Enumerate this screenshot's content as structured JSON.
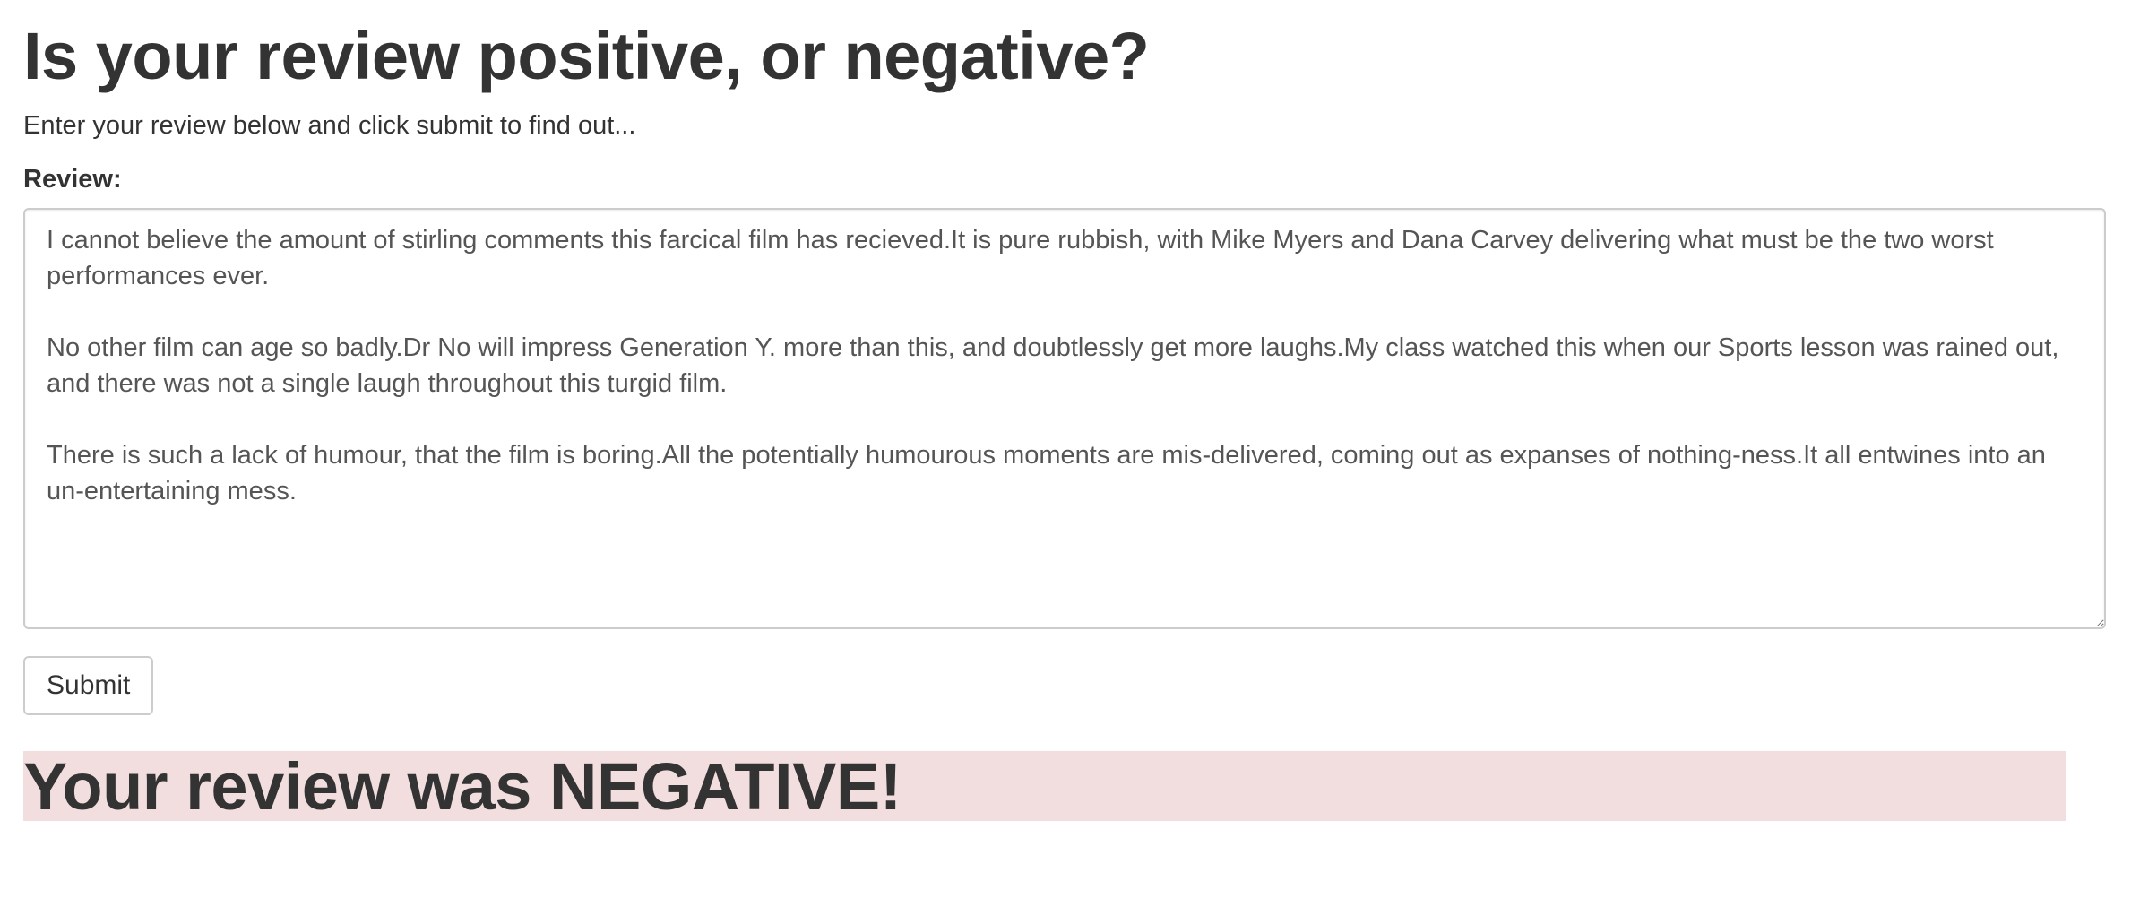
{
  "page": {
    "title": "Is your review positive, or negative?",
    "subtitle": "Enter your review below and click submit to find out...",
    "review_label": "Review:",
    "review_text": "I cannot believe the amount of stirling comments this farcical film has recieved.It is pure rubbish, with Mike Myers and Dana Carvey delivering what must be the two worst performances ever.\n\nNo other film can age so badly.Dr No will impress Generation Y. more than this, and doubtlessly get more laughs.My class watched this when our Sports lesson was rained out, and there was not a single laugh throughout this turgid film.\n\nThere is such a lack of humour, that the film is boring.All the potentially humourous moments are mis-delivered, coming out as expanses of nothing-ness.It all entwines into an un-entertaining mess.",
    "submit_label": "Submit",
    "result": "Your review was NEGATIVE!"
  },
  "colors": {
    "text": "#333333",
    "negative_banner": "#f2dede",
    "border": "#cccccc"
  }
}
